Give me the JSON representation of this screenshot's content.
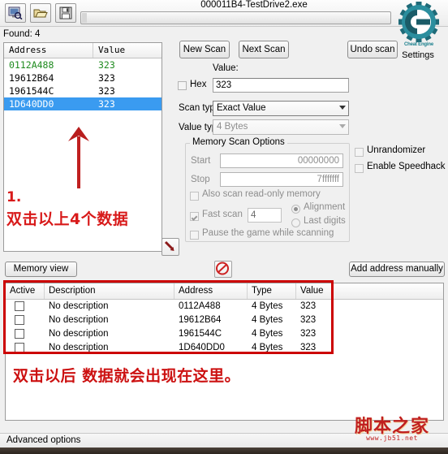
{
  "window": {
    "title": "000011B4-TestDrive2.exe",
    "found_label": "Found: 4"
  },
  "toolbar": {
    "buttons": [
      {
        "name": "open-process",
        "icon": "process-select-icon"
      },
      {
        "name": "open-file",
        "icon": "folder-open-icon"
      },
      {
        "name": "save-file",
        "icon": "floppy-save-icon"
      }
    ],
    "progress_value": 0
  },
  "logo": {
    "caption": "Cheat Engine",
    "settings_label": "Settings"
  },
  "results": {
    "columns": [
      "Address",
      "Value"
    ],
    "rows": [
      {
        "address": "0112A488",
        "value": "323",
        "style": "green"
      },
      {
        "address": "19612B64",
        "value": "323",
        "style": "normal"
      },
      {
        "address": "1961544C",
        "value": "323",
        "style": "normal"
      },
      {
        "address": "1D640DD0",
        "value": "323",
        "style": "selected"
      }
    ]
  },
  "scan": {
    "new_scan": "New Scan",
    "next_scan": "Next Scan",
    "undo_scan": "Undo scan",
    "value_label": "Value:",
    "hex_label": "Hex",
    "hex_checked": false,
    "value_input": "323",
    "scan_type_label": "Scan type",
    "scan_type_value": "Exact Value",
    "value_type_label": "Value type",
    "value_type_value": "4 Bytes"
  },
  "memory_scan_options": {
    "title": "Memory Scan Options",
    "start_label": "Start",
    "start_value": "00000000",
    "stop_label": "Stop",
    "stop_value": "7fffffff",
    "readonly_label": "Also scan read-only memory",
    "readonly_checked": false,
    "fast_scan_label": "Fast scan",
    "fast_scan_checked": true,
    "fast_scan_value": "4",
    "alignment_label": "Alignment",
    "alignment_selected": true,
    "last_digits_label": "Last digits",
    "last_digits_selected": false,
    "pause_label": "Pause the game while scanning",
    "pause_checked": false
  },
  "extras": {
    "unrandomizer_label": "Unrandomizer",
    "unrandomizer_checked": false,
    "speedhack_label": "Enable Speedhack",
    "speedhack_checked": false
  },
  "actions": {
    "memory_view": "Memory view",
    "add_address_manually": "Add address manually",
    "pointer_icon": "red-arrow-pointer-icon",
    "no_entry_icon": "no-entry-icon"
  },
  "cheat_table": {
    "columns": [
      "Active",
      "Description",
      "Address",
      "Type",
      "Value"
    ],
    "rows": [
      {
        "active": false,
        "description": "No description",
        "address": "0112A488",
        "type": "4 Bytes",
        "value": "323"
      },
      {
        "active": false,
        "description": "No description",
        "address": "19612B64",
        "type": "4 Bytes",
        "value": "323"
      },
      {
        "active": false,
        "description": "No description",
        "address": "1961544C",
        "type": "4 Bytes",
        "value": "323"
      },
      {
        "active": false,
        "description": "No description",
        "address": "1D640DD0",
        "type": "4 Bytes",
        "value": "323"
      }
    ]
  },
  "annotations": {
    "step_number": "1.",
    "step_text": "双击以上4个数据",
    "result_text": "双击以后 数据就会出现在这里。",
    "accent_color": "#cc1111"
  },
  "statusbar": {
    "text": "Advanced options"
  },
  "watermark": {
    "text": "脚本之家",
    "url": "www.jb51.net"
  }
}
